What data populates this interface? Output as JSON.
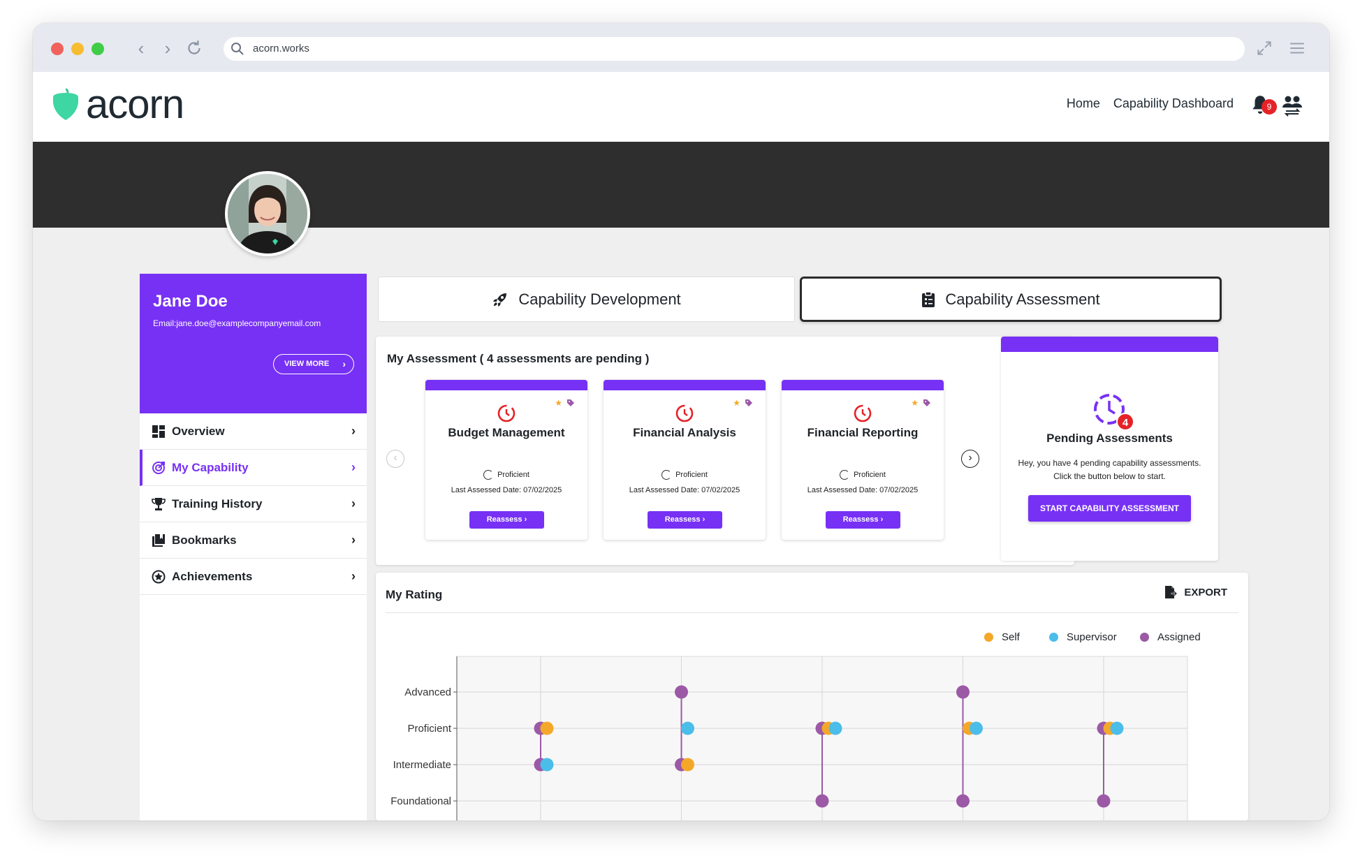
{
  "browser": {
    "url": "acorn.works"
  },
  "header": {
    "logo_text": "acorn",
    "nav": [
      "Home",
      "Capability Dashboard"
    ],
    "notification_count": "9"
  },
  "profile": {
    "name": "Jane Doe",
    "email": "Email:jane.doe@examplecompanyemail.com",
    "view_more": "VIEW MORE"
  },
  "menu": [
    {
      "label": "Overview",
      "icon": "dashboard-icon",
      "active": false
    },
    {
      "label": "My Capability",
      "icon": "target-icon",
      "active": true
    },
    {
      "label": "Training History",
      "icon": "trophy-icon",
      "active": false
    },
    {
      "label": "Bookmarks",
      "icon": "bookmark-icon",
      "active": false
    },
    {
      "label": "Achievements",
      "icon": "star-badge-icon",
      "active": false
    }
  ],
  "tabs": {
    "development": "Capability Development",
    "assessment": "Capability Assessment"
  },
  "my_assessment": {
    "title": "My Assessment ( 4 assessments are pending )",
    "cards": [
      {
        "title": "Budget Management",
        "level": "Proficient",
        "date": "Last Assessed Date: 07/02/2025",
        "button": "Reassess"
      },
      {
        "title": "Financial Analysis",
        "level": "Proficient",
        "date": "Last Assessed Date: 07/02/2025",
        "button": "Reassess"
      },
      {
        "title": "Financial Reporting",
        "level": "Proficient",
        "date": "Last Assessed Date: 07/02/2025",
        "button": "Reassess"
      }
    ]
  },
  "pending": {
    "count": "4",
    "title": "Pending Assessments",
    "text_line1": "Hey, you have 4 pending capability assessments.",
    "text_line2": "Click the button below to start.",
    "button": "START CAPABILITY ASSESSMENT"
  },
  "rating": {
    "title": "My Rating",
    "export": "EXPORT"
  },
  "colors": {
    "accent": "#7731f4",
    "self": "#f4a82a",
    "supervisor": "#4bbde9",
    "assigned": "#9b59a6",
    "badge": "#e42228"
  },
  "chart_data": {
    "type": "scatter",
    "y_categories": [
      "Foundational",
      "Intermediate",
      "Proficient",
      "Advanced"
    ],
    "legend": [
      "Self",
      "Supervisor",
      "Assigned"
    ],
    "legend_position": "top-right",
    "grid": true,
    "series": [
      {
        "name": "Self",
        "values": [
          "Proficient",
          "Intermediate",
          "Proficient",
          "Proficient",
          "Proficient"
        ]
      },
      {
        "name": "Supervisor",
        "values": [
          "Intermediate",
          "Proficient",
          "Proficient",
          "Proficient",
          "Proficient"
        ]
      },
      {
        "name": "Assigned",
        "values": [
          [
            "Proficient",
            "Intermediate"
          ],
          [
            "Advanced",
            "Intermediate"
          ],
          [
            "Proficient",
            "Foundational"
          ],
          [
            "Advanced",
            "Foundational"
          ],
          [
            "Proficient",
            "Foundational"
          ]
        ]
      }
    ]
  }
}
